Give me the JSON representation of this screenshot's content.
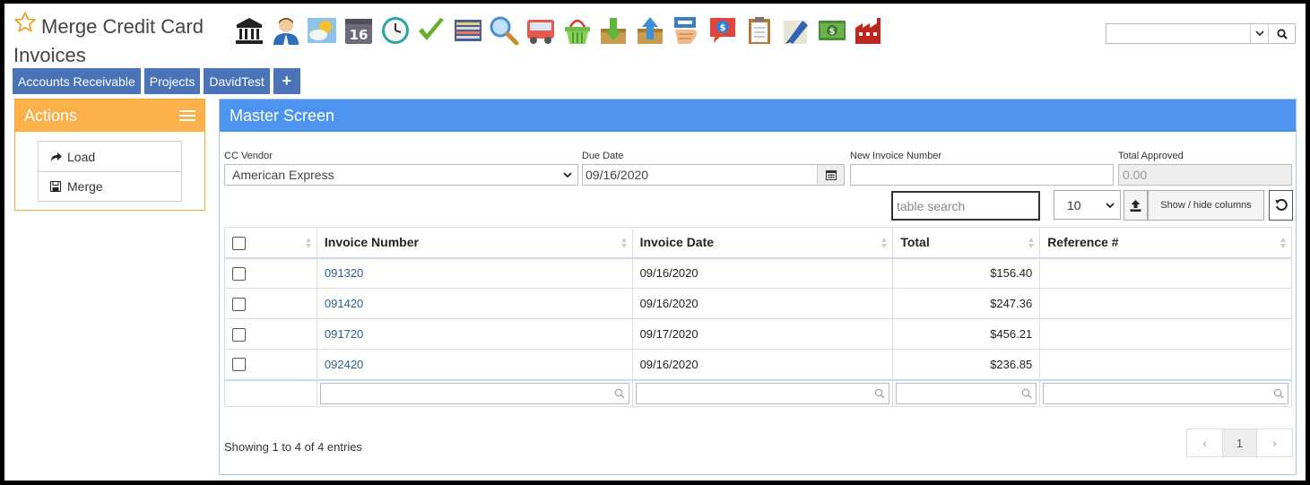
{
  "page": {
    "title": "Merge Credit Card Invoices"
  },
  "toolbar": {
    "icons": [
      "bank-icon",
      "user-icon",
      "weather-icon",
      "calendar-16-icon",
      "clock-icon",
      "checkmark-icon",
      "keyboard-icon",
      "magnifier-icon",
      "truck-icon",
      "basket-icon",
      "download-box-icon",
      "upload-box-icon",
      "hand-card-icon",
      "chat-dollar-icon",
      "clipboard-icon",
      "pencil-icon",
      "cash-icon",
      "factory-icon"
    ],
    "calendar_number": "16"
  },
  "global_search": {
    "value": ""
  },
  "tabs": [
    {
      "label": "Accounts Receivable"
    },
    {
      "label": "Projects"
    },
    {
      "label": "DavidTest"
    },
    {
      "label": "+"
    }
  ],
  "actions": {
    "title": "Actions",
    "items": [
      {
        "label": "Load",
        "icon": "share-arrow-icon"
      },
      {
        "label": "Merge",
        "icon": "save-icon"
      }
    ]
  },
  "master": {
    "title": "Master Screen",
    "fields": {
      "vendor": {
        "label": "CC Vendor",
        "value": "American Express"
      },
      "due_date": {
        "label": "Due Date",
        "value": "09/16/2020"
      },
      "new_invoice_number": {
        "label": "New Invoice Number",
        "value": ""
      },
      "total_approved": {
        "label": "Total Approved",
        "value": "0.00"
      }
    },
    "table_search": {
      "placeholder": "table search"
    },
    "page_size": "10",
    "show_hide_label": "Show / hide columns",
    "columns": [
      "",
      "Invoice Number",
      "Invoice Date",
      "Total",
      "Reference #"
    ],
    "rows": [
      {
        "invoice_number": "091320",
        "invoice_date": "09/16/2020",
        "total": "$156.40",
        "reference": ""
      },
      {
        "invoice_number": "091420",
        "invoice_date": "09/16/2020",
        "total": "$247.36",
        "reference": ""
      },
      {
        "invoice_number": "091720",
        "invoice_date": "09/17/2020",
        "total": "$456.21",
        "reference": ""
      },
      {
        "invoice_number": "092420",
        "invoice_date": "09/16/2020",
        "total": "$236.85",
        "reference": ""
      }
    ],
    "showing": "Showing 1 to 4 of 4 entries",
    "pager": {
      "prev": "‹",
      "current": "1",
      "next": "›"
    }
  },
  "colors": {
    "tab_blue": "#4a73b8",
    "actions_orange": "#fbb14a",
    "master_blue": "#4d94f0",
    "link_blue": "#2e5c99"
  }
}
